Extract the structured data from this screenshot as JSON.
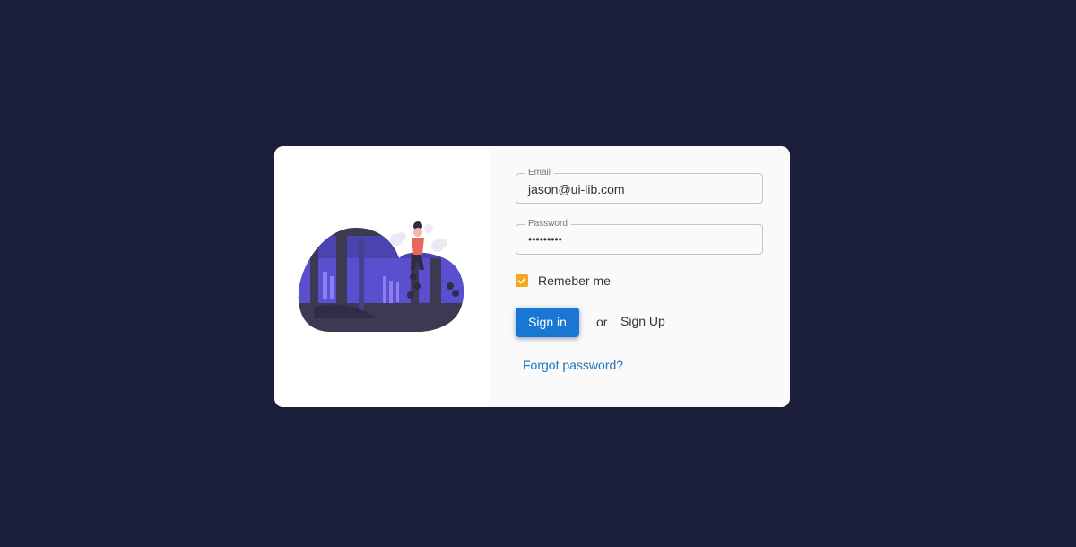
{
  "login": {
    "email_label": "Email",
    "email_value": "jason@ui-lib.com",
    "password_label": "Password",
    "password_value": "•••••••••",
    "remember_label": "Remeber me",
    "remember_checked": true,
    "signin_label": "Sign in",
    "or_text": "or",
    "signup_label": "Sign Up",
    "forgot_label": "Forgot password?"
  },
  "colors": {
    "background": "#1b1f3b",
    "primary": "#1976d2",
    "checkbox": "#f5a623",
    "link": "#1e72b8"
  },
  "icons": [
    "check-icon",
    "forest-person-illustration"
  ]
}
